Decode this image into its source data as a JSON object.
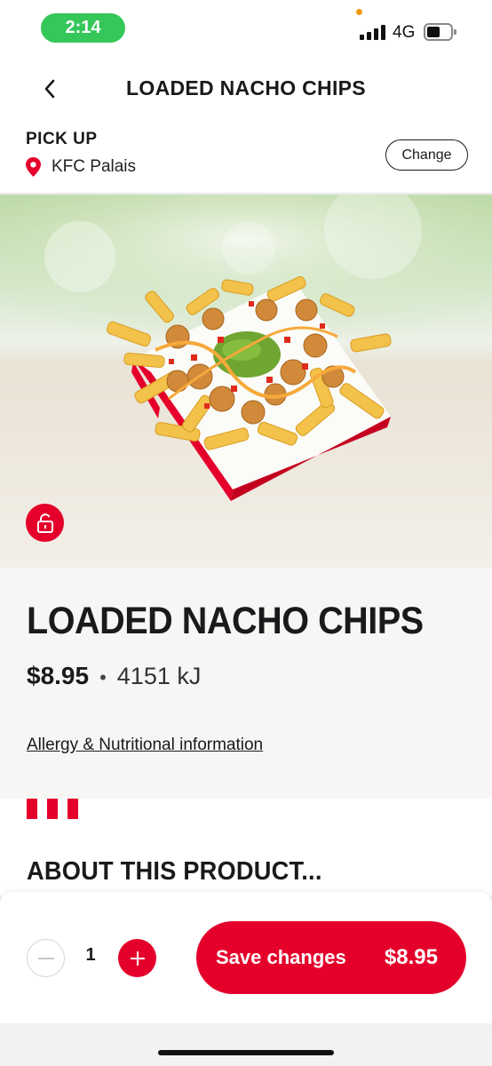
{
  "status_bar": {
    "time": "2:14",
    "network": "4G",
    "battery_level": 0.55,
    "colors": {
      "time_pill": "#35c759",
      "indicator_dot": "#f19a0e"
    }
  },
  "header": {
    "title": "LOADED NACHO CHIPS",
    "back_icon": "chevron-left-icon"
  },
  "pickup": {
    "label": "PICK UP",
    "store": "KFC Palais",
    "store_icon": "location-pin-icon",
    "change_label": "Change"
  },
  "hero": {
    "image": "loaded-nacho-chips-photo",
    "badge_icon": "unlock-icon"
  },
  "product": {
    "name": "LOADED NACHO CHIPS",
    "price": "$8.95",
    "separator": "•",
    "energy": "4151 kJ",
    "allergy_link": "Allergy & Nutritional information"
  },
  "about": {
    "title": "ABOUT THIS PRODUCT..."
  },
  "cart_bar": {
    "quantity": "1",
    "minus_icon": "minus-icon",
    "plus_icon": "plus-icon",
    "save_label": "Save changes",
    "save_price": "$8.95"
  },
  "theme": {
    "brand_red": "#e4002b",
    "text": "#1a1a1a"
  }
}
